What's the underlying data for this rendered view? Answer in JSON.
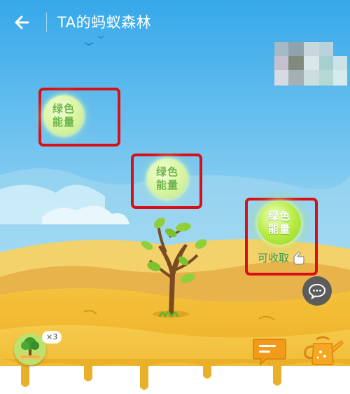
{
  "header": {
    "title": "TA的蚂蚁森林",
    "back_icon": "arrow-left-icon"
  },
  "energy_balls": [
    {
      "line1": "绿色",
      "line2": "能量",
      "state": "growing"
    },
    {
      "line1": "绿色",
      "line2": "能量",
      "state": "growing"
    },
    {
      "line1": "绿色",
      "line2": "能量",
      "state": "ripe"
    }
  ],
  "collect": {
    "label": "可收取",
    "icon": "pointing-hand-icon"
  },
  "tree_badge": {
    "count": "×3",
    "icon": "tree-icon"
  },
  "actions": {
    "chat_icon": "chat-bubble-icon",
    "message_icon": "message-icon",
    "water_icon": "watering-can-icon"
  },
  "colors": {
    "sky_top": "#36a8ea",
    "sky_bottom": "#b7e4f7",
    "sand": "#f1b92c",
    "highlight_border": "#d90f18",
    "energy_text": "#6cb64a",
    "collect_text": "#2f9c57"
  }
}
